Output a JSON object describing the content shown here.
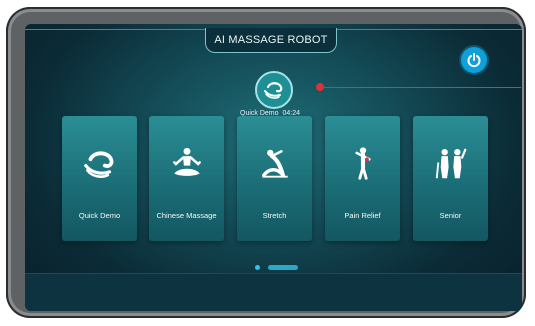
{
  "header": {
    "title": "AI MASSAGE ROBOT",
    "power_icon": "power-icon"
  },
  "now_playing": {
    "name": "Quick Demo",
    "time": "04:24",
    "icon": "hand-icon"
  },
  "programs": [
    {
      "label": "Quick Demo",
      "icon": "hand-icon"
    },
    {
      "label": "Chinese Massage",
      "icon": "meditation-icon"
    },
    {
      "label": "Stretch",
      "icon": "yoga-stretch-icon"
    },
    {
      "label": "Pain Relief",
      "icon": "body-pain-icon"
    },
    {
      "label": "Senior",
      "icon": "elderly-couple-icon"
    }
  ],
  "pagination": {
    "current": 1,
    "total": 2
  },
  "colors": {
    "accent": "#33c3e6",
    "power": "#0fa0da",
    "card": "#1b6e77",
    "pointer": "#e0303a"
  }
}
